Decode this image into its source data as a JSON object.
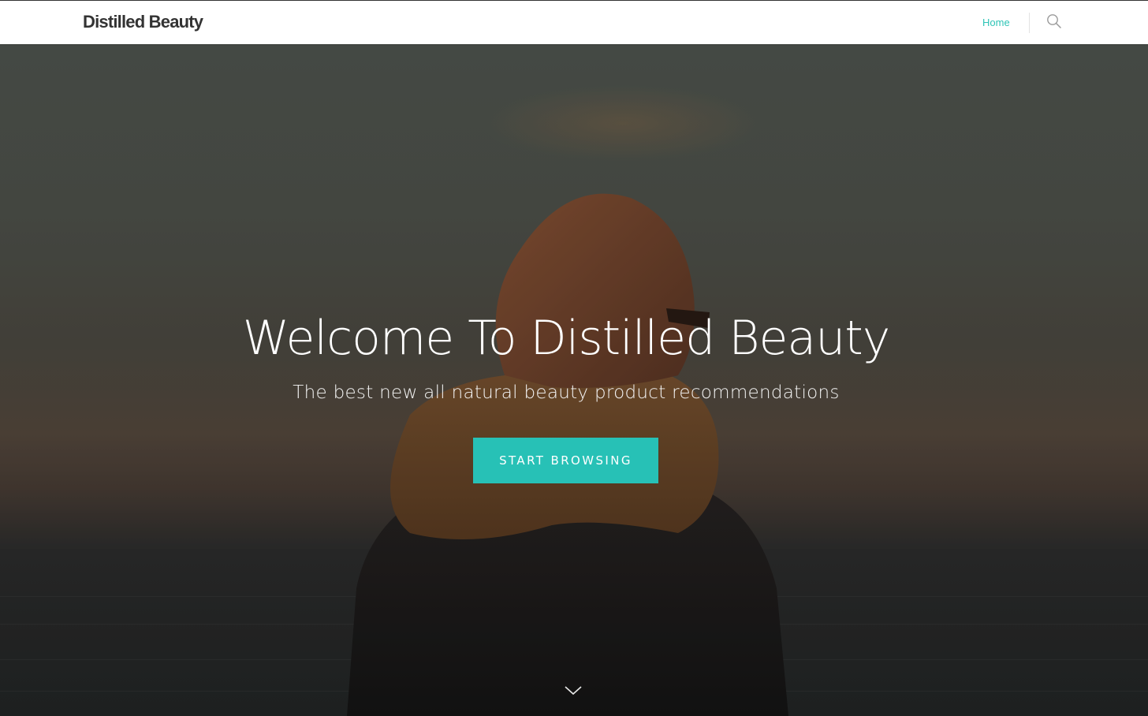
{
  "header": {
    "logo": "Distilled Beauty",
    "nav": {
      "home_label": "Home"
    },
    "search_icon": "search-icon",
    "accent_color": "#2ec4b6"
  },
  "hero": {
    "title": "Welcome To Distilled Beauty",
    "subtitle": "The best new all natural beauty product recommendations",
    "cta_label": "START BROWSING",
    "cta_color": "#27c1b6",
    "scroll_icon": "chevron-down-icon"
  }
}
